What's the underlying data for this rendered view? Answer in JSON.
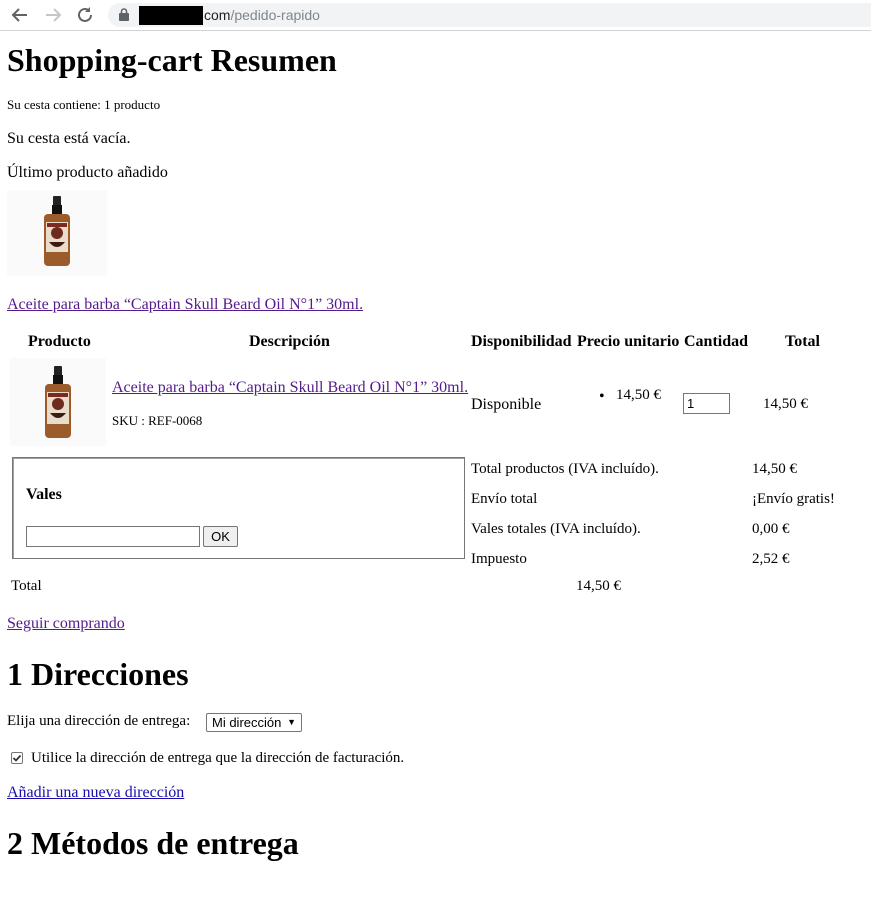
{
  "browser": {
    "url_host": "com",
    "url_path": "/pedido-rapido"
  },
  "page_title": "Shopping-cart Resumen",
  "cart_count": "Su cesta contiene: 1 producto",
  "cart_empty": "Su cesta está vacía.",
  "last_added": {
    "label": "Último producto añadido",
    "product_link": "Aceite para barba “Captain Skull Beard Oil N°1” 30ml."
  },
  "table": {
    "headers": [
      "Producto",
      "Descripción",
      "Disponibilidad",
      "Precio unitario",
      "Cantidad",
      "Total"
    ],
    "row": {
      "name": "Aceite para barba “Captain Skull Beard Oil N°1” 30ml.",
      "sku": "SKU : REF-0068",
      "availability": "Disponible",
      "unit_price": "14,50 €",
      "quantity": "1",
      "total": "14,50 €"
    }
  },
  "vouchers": {
    "title": "Vales",
    "input_value": "",
    "ok_label": "OK"
  },
  "summary": {
    "products_label": "Total productos (IVA incluído).",
    "products_value": "14,50 €",
    "shipping_label": "Envío total",
    "shipping_value": "¡Envío gratis!",
    "vouchers_label": "Vales totales (IVA incluído).",
    "vouchers_value": "0,00 €",
    "tax_label": "Impuesto",
    "tax_value": "2,52 €",
    "total_label": "Total",
    "total_value": "14,50 €"
  },
  "continue_shopping": "Seguir comprando",
  "addresses": {
    "heading": "1 Direcciones",
    "select_label": "Elija una dirección de entrega:",
    "select_value": "Mi dirección",
    "same_address_label": "Utilice la dirección de entrega que la dirección de facturación.",
    "same_address_checked": true,
    "add_new_link": "Añadir una nueva dirección"
  },
  "shipping_methods": {
    "heading": "2 Métodos de entrega"
  }
}
